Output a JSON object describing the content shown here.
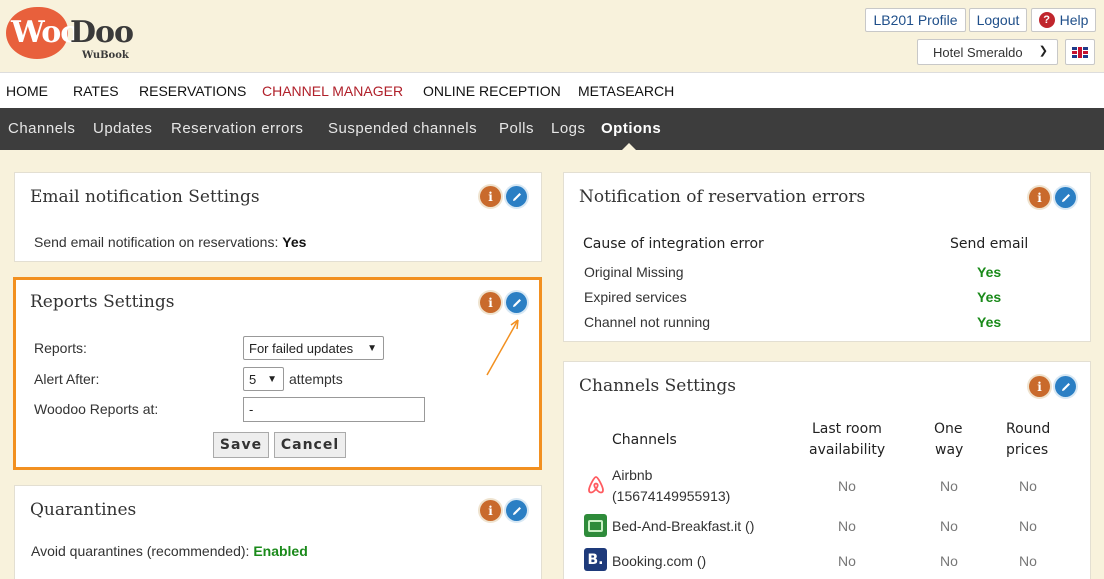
{
  "logo": {
    "part1": "Woo",
    "part2": "Doo",
    "sub": "WuBook"
  },
  "top": {
    "profile": "LB201 Profile",
    "logout": "Logout",
    "help": "Help",
    "hotel": "Hotel Smeraldo"
  },
  "main_nav": [
    "HOME",
    "RATES",
    "RESERVATIONS",
    "CHANNEL MANAGER",
    "ONLINE RECEPTION",
    "METASEARCH"
  ],
  "sub_nav": [
    "Channels",
    "Updates",
    "Reservation errors",
    "Suspended channels",
    "Polls",
    "Logs",
    "Options"
  ],
  "email_panel": {
    "title": "Email notification Settings",
    "label": "Send email notification on reservations:",
    "value": "Yes"
  },
  "reports_panel": {
    "title": "Reports Settings",
    "reports_label": "Reports:",
    "reports_value": "For failed updates",
    "alert_label": "Alert After:",
    "alert_value": "5",
    "alert_suffix": "attempts",
    "woodoo_label": "Woodoo Reports at:",
    "woodoo_value": "-",
    "save": "Save",
    "cancel": "Cancel"
  },
  "quarantines_panel": {
    "title": "Quarantines",
    "label": "Avoid quarantines (recommended):",
    "value": "Enabled"
  },
  "errors_panel": {
    "title": "Notification of reservation errors",
    "col1": "Cause of integration error",
    "col2": "Send email",
    "rows": [
      {
        "cause": "Original Missing",
        "send": "Yes"
      },
      {
        "cause": "Expired services",
        "send": "Yes"
      },
      {
        "cause": "Channel not running",
        "send": "Yes"
      }
    ]
  },
  "channels_panel": {
    "title": "Channels Settings",
    "headers": {
      "channels": "Channels",
      "last_room_1": "Last room",
      "last_room_2": "availability",
      "one_way_1": "One",
      "one_way_2": "way",
      "round_1": "Round",
      "round_2": "prices"
    },
    "rows": [
      {
        "name": "Airbnb",
        "name2": "(15674149955913)",
        "icon": "airbnb-icon",
        "last": "No",
        "one": "No",
        "round": "No"
      },
      {
        "name": "Bed-And-Breakfast.it ()",
        "icon": "bed-and-breakfast-icon",
        "last": "No",
        "one": "No",
        "round": "No"
      },
      {
        "name": "Booking.com ()",
        "icon": "booking-icon",
        "last": "No",
        "one": "No",
        "round": "No"
      }
    ]
  },
  "colors": {
    "accent": "#b0202a",
    "highlight": "#f29020",
    "yes": "#1a8a1a",
    "nav_dark": "#3d3d3d"
  }
}
